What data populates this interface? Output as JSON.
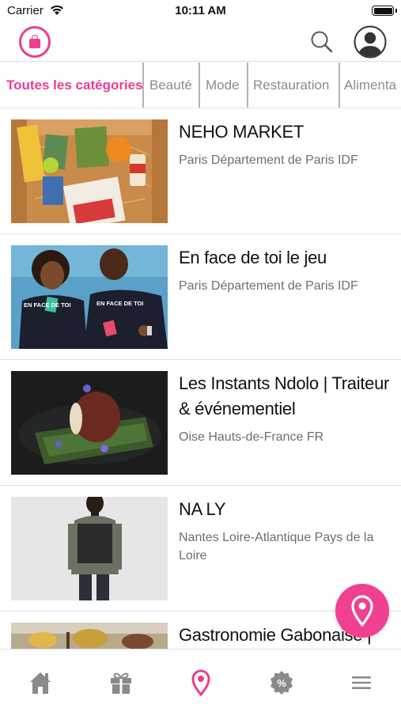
{
  "status_bar": {
    "carrier": "Carrier",
    "time": "10:11 AM"
  },
  "header": {
    "logo_icon": "shopping-bag-logo",
    "search_icon": "search-icon",
    "profile_icon": "user-avatar-icon"
  },
  "categories": [
    {
      "label": "Toutes les catégories",
      "active": true
    },
    {
      "label": "Beauté",
      "active": false
    },
    {
      "label": "Mode",
      "active": false
    },
    {
      "label": "Restauration",
      "active": false
    },
    {
      "label": "Alimenta",
      "active": false
    }
  ],
  "listings": [
    {
      "title": "NEHO MARKET",
      "location": "Paris Département de Paris IDF",
      "image": "gift-box-products-photo"
    },
    {
      "title": "En face de toi le jeu",
      "location": "Paris Département de Paris IDF",
      "image": "couple-holding-cards-photo",
      "image_text": "EN FACE DE TOI"
    },
    {
      "title": "Les Instants Ndolo | Traiteur & événementiel",
      "location": "Oise Hauts-de-France FR",
      "image": "plated-dish-photo"
    },
    {
      "title": "NA LY",
      "location": "Nantes Loire-Atlantique Pays de la Loire",
      "image": "fashion-model-photo"
    },
    {
      "title": "Gastronomie Gabonaise |",
      "location": "",
      "image": "market-food-photo"
    }
  ],
  "fab": {
    "icon": "map-pin-icon",
    "color": "#f0408f"
  },
  "bottom_nav": [
    {
      "name": "home",
      "icon": "home-icon",
      "active": false
    },
    {
      "name": "gifts",
      "icon": "gift-icon",
      "active": false
    },
    {
      "name": "map",
      "icon": "map-pin-icon",
      "active": true
    },
    {
      "name": "offers",
      "icon": "discount-badge-icon",
      "active": false
    },
    {
      "name": "menu",
      "icon": "menu-icon",
      "active": false
    }
  ],
  "colors": {
    "accent": "#ee3c8f",
    "inactive_icon": "#8a8a8a",
    "muted_text": "#6e6e6e"
  }
}
